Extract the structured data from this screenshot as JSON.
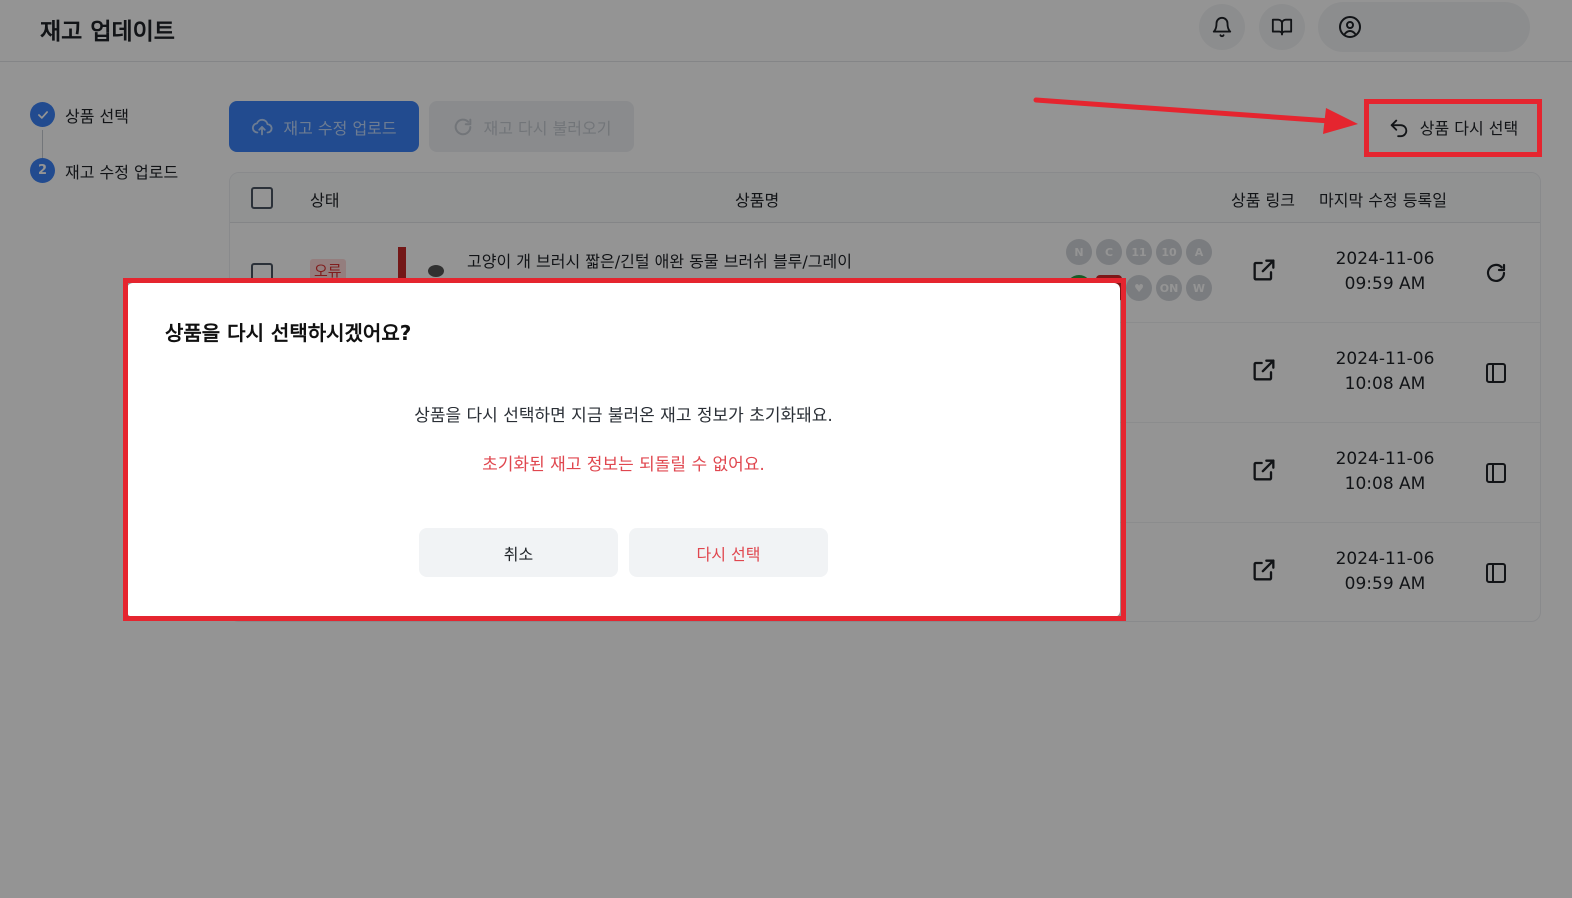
{
  "header": {
    "title": "재고 업데이트"
  },
  "stepper": {
    "steps": [
      {
        "number": "",
        "label": "상품 선택"
      },
      {
        "number": "2",
        "label": "재고 수정 업로드"
      }
    ]
  },
  "toolbar": {
    "upload_label": "재고 수정 업로드",
    "reload_label": "재고 다시 불러오기",
    "reselect_label": "상품 다시 선택"
  },
  "table": {
    "columns": {
      "status": "상태",
      "name": "상품명",
      "link": "상품 링크",
      "modified": "마지막 수정 등록일"
    },
    "rows": [
      {
        "status": "오류",
        "name": "고양이 개 브러시 짧은/긴털 애완 동물 브러쉬 블루/그레이",
        "date": "2024-11-06",
        "time": "09:59 AM",
        "action_icon": "refresh-icon"
      },
      {
        "status": "",
        "name": "",
        "date": "2024-11-06",
        "time": "10:08 AM",
        "action_icon": "side-panel-icon"
      },
      {
        "status": "",
        "name": "",
        "date": "2024-11-06",
        "time": "10:08 AM",
        "action_icon": "side-panel-icon"
      },
      {
        "status": "",
        "name": "",
        "date": "2024-11-06",
        "time": "09:59 AM",
        "action_icon": "side-panel-icon"
      }
    ],
    "channel_badges": [
      "N",
      "C",
      "11",
      "10",
      "A",
      "G",
      "Y",
      "♥",
      "ON",
      "W"
    ]
  },
  "modal": {
    "title": "상품을 다시 선택하시겠어요?",
    "message": "상품을 다시 선택하면 지금 불러온 재고 정보가 초기화돼요.",
    "warning": "초기화된 재고 정보는 되돌릴 수 없어요.",
    "cancel_label": "취소",
    "confirm_label": "다시 선택"
  },
  "colors": {
    "primary": "#3b82f6",
    "danger": "#e0474f",
    "annotation": "#e5252f"
  }
}
